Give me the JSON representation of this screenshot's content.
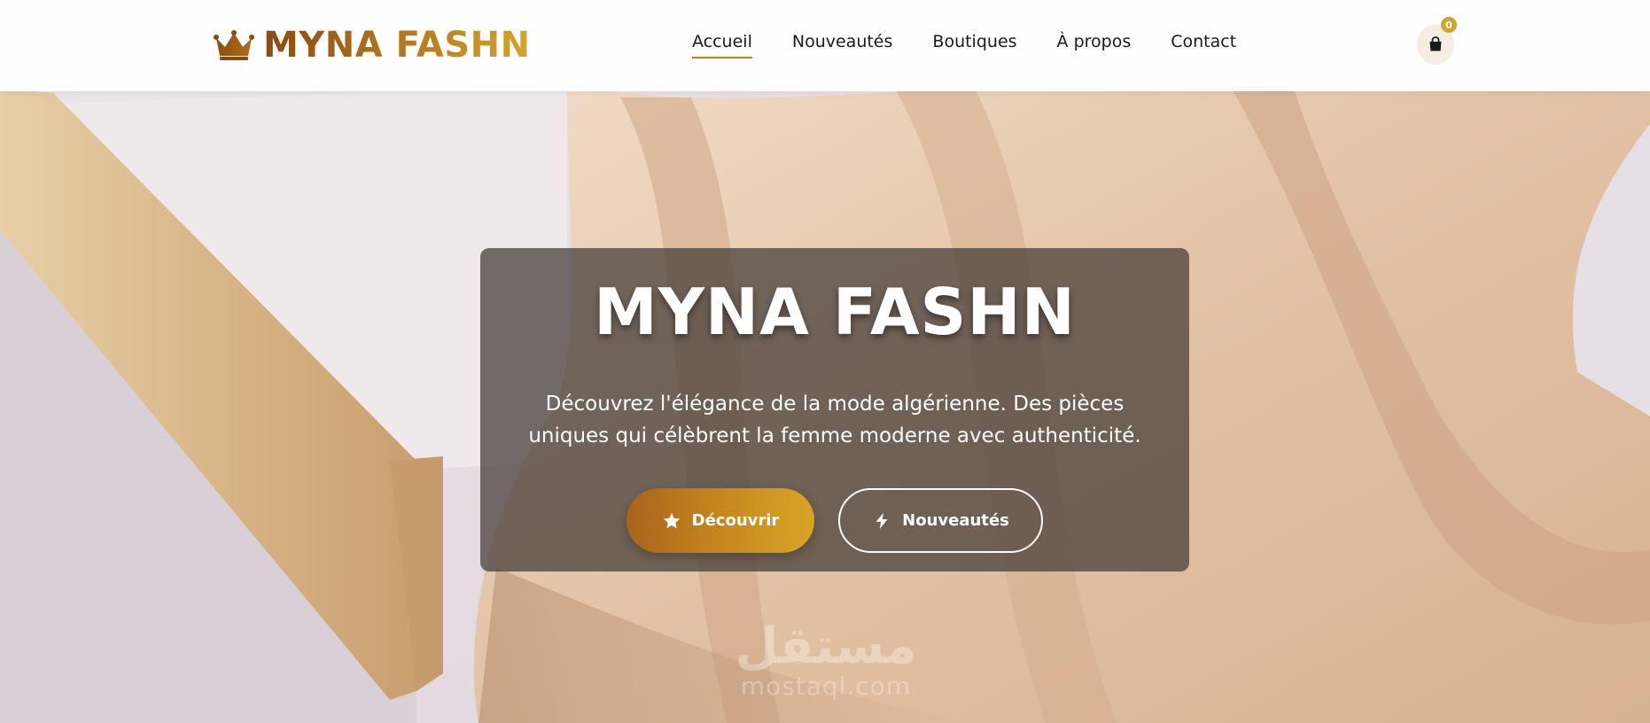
{
  "brand": {
    "name": "MYNA FASHN",
    "icon": "crown-icon",
    "gradient": [
      "#8a4b12",
      "#d6a52c"
    ]
  },
  "nav": {
    "items": [
      {
        "label": "Accueil",
        "active": true
      },
      {
        "label": "Nouveautés",
        "active": false
      },
      {
        "label": "Boutiques",
        "active": false
      },
      {
        "label": "À propos",
        "active": false
      },
      {
        "label": "Contact",
        "active": false
      }
    ],
    "active_underline_color": "#b8861f"
  },
  "cart": {
    "icon": "shopping-bag-icon",
    "count": "0",
    "badge_color": "#d1a430"
  },
  "hero": {
    "title": "MYNA FASHN",
    "subtitle": "Découvrez l'élégance de la mode algérienne. Des pièces uniques qui célèbrent la femme moderne avec authenticité.",
    "primary_button": {
      "label": "Découvrir",
      "icon": "star-icon"
    },
    "secondary_button": {
      "label": "Nouveautés",
      "icon": "bolt-icon"
    }
  },
  "watermark": {
    "arabic": "مستقل",
    "latin": "mostaql.com"
  }
}
